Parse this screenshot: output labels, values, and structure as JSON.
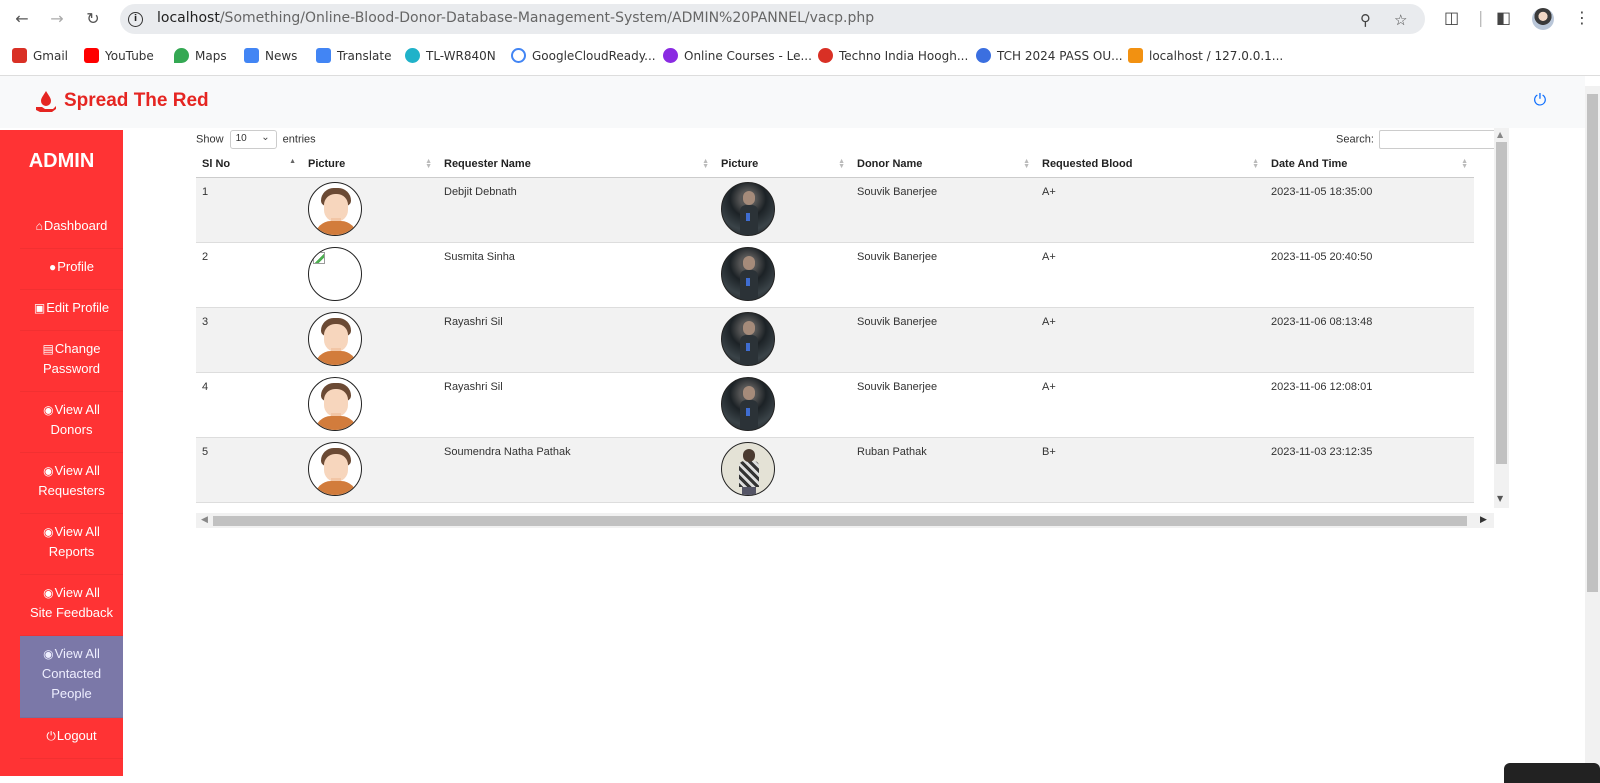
{
  "browser": {
    "url_host": "localhost",
    "url_path": "/Something/Online-Blood-Donor-Database-Management-System/ADMIN%20PANNEL/vacp.php",
    "bookmarks": [
      {
        "label": "Gmail",
        "color": "#d93025"
      },
      {
        "label": "YouTube",
        "color": "#ff0000"
      },
      {
        "label": "Maps",
        "color": "#34a853"
      },
      {
        "label": "News",
        "color": "#4285f4"
      },
      {
        "label": "Translate",
        "color": "#4285f4"
      },
      {
        "label": "TL-WR840N",
        "color": "#20b2c9"
      },
      {
        "label": "GoogleCloudReady...",
        "color": "#4285f4"
      },
      {
        "label": "Online Courses - Le...",
        "color": "#8a2be2"
      },
      {
        "label": "Techno India Hoogh...",
        "color": "#d93025"
      },
      {
        "label": "TCH 2024 PASS OU...",
        "color": "#3b6fe0"
      },
      {
        "label": "localhost / 127.0.0.1...",
        "color": "#f29111"
      }
    ]
  },
  "brand": {
    "name": "Spread The Red",
    "color": "#e52521"
  },
  "sidebar": {
    "title": "ADMIN",
    "items": [
      {
        "icon": "home-icon",
        "line1": "Dashboard",
        "line2": "",
        "line3": ""
      },
      {
        "icon": "user-icon",
        "line1": "Profile",
        "line2": "",
        "line3": ""
      },
      {
        "icon": "id-card-icon",
        "line1": "Edit Profile",
        "line2": "",
        "line3": ""
      },
      {
        "icon": "file-icon",
        "line1": "Change",
        "line2": "Password",
        "line3": ""
      },
      {
        "icon": "eye-icon",
        "line1": "View All",
        "line2": "Donors",
        "line3": ""
      },
      {
        "icon": "eye-icon",
        "line1": "View All",
        "line2": "Requesters",
        "line3": ""
      },
      {
        "icon": "eye-icon",
        "line1": "View All",
        "line2": "Reports",
        "line3": ""
      },
      {
        "icon": "eye-icon",
        "line1": "View All",
        "line2": "Site Feedback",
        "line3": ""
      },
      {
        "icon": "eye-icon",
        "line1": "View All",
        "line2": "Contacted",
        "line3": "People"
      },
      {
        "icon": "power-icon",
        "line1": "Logout",
        "line2": "",
        "line3": ""
      }
    ],
    "active_index": 8,
    "bg_color": "#ff3334",
    "active_color": "#7b78a8"
  },
  "table_controls": {
    "show_label": "Show",
    "entries_value": "10",
    "entries_label": "entries",
    "search_label": "Search:",
    "search_value": ""
  },
  "table": {
    "columns": [
      "Sl No",
      "Picture",
      "Requester Name",
      "Picture",
      "Donor Name",
      "Requested Blood",
      "Date And Time"
    ],
    "rows": [
      {
        "sl": "1",
        "requester_pic": "cartoon-avatar",
        "requester": "Debjit Debnath",
        "donor_pic": "photo-dark",
        "donor": "Souvik Banerjee",
        "blood": "A+",
        "datetime": "2023-11-05 18:35:00"
      },
      {
        "sl": "2",
        "requester_pic": "broken-image",
        "requester": "Susmita Sinha",
        "donor_pic": "photo-dark",
        "donor": "Souvik Banerjee",
        "blood": "A+",
        "datetime": "2023-11-05 20:40:50"
      },
      {
        "sl": "3",
        "requester_pic": "cartoon-avatar",
        "requester": "Rayashri Sil",
        "donor_pic": "photo-dark",
        "donor": "Souvik Banerjee",
        "blood": "A+",
        "datetime": "2023-11-06 08:13:48"
      },
      {
        "sl": "4",
        "requester_pic": "cartoon-avatar",
        "requester": "Rayashri Sil",
        "donor_pic": "photo-dark",
        "donor": "Souvik Banerjee",
        "blood": "A+",
        "datetime": "2023-11-06 12:08:01"
      },
      {
        "sl": "5",
        "requester_pic": "cartoon-avatar",
        "requester": "Soumendra Natha Pathak",
        "donor_pic": "photo-light",
        "donor": "Ruban Pathak",
        "blood": "B+",
        "datetime": "2023-11-03 23:12:35"
      }
    ]
  }
}
